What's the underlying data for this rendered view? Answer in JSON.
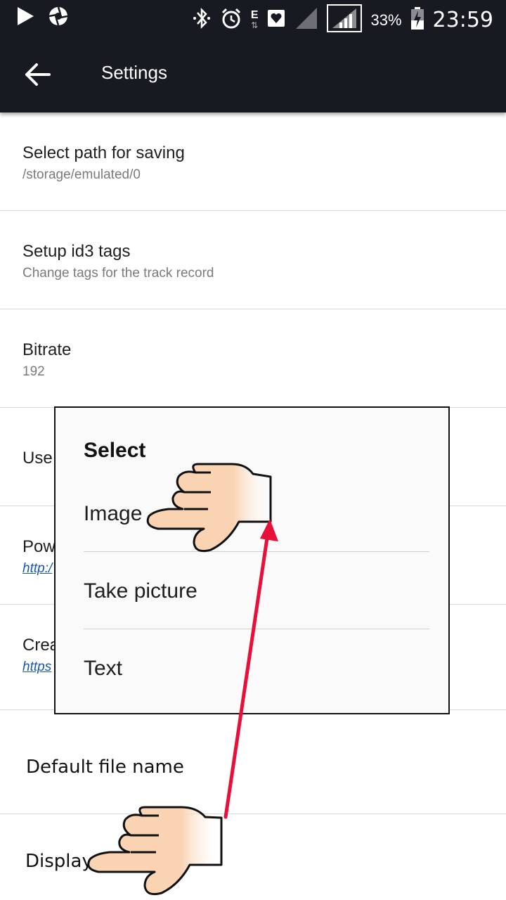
{
  "status_bar": {
    "battery_percent": "33%",
    "time": "23:59",
    "network_letter": "E"
  },
  "app_bar": {
    "title": "Settings"
  },
  "settings": [
    {
      "title": "Select path for saving",
      "subtitle": "/storage/emulated/0"
    },
    {
      "title": "Setup id3 tags",
      "subtitle": "Change tags for the track record"
    },
    {
      "title": "Bitrate",
      "subtitle": "192"
    },
    {
      "title": "Use"
    },
    {
      "title": "Pow",
      "link": "http:/"
    },
    {
      "title": "Crea",
      "link": "https"
    }
  ],
  "annotations": {
    "default_file_name": "Default file name",
    "display": "Display"
  },
  "dialog": {
    "title": "Select",
    "options": [
      "Image",
      "Take picture",
      "Text"
    ]
  },
  "colors": {
    "bar_bg": "#181a22",
    "arrow": "#e8103a",
    "hand_skin": "#f9d3b2",
    "link": "#1a57b5"
  }
}
